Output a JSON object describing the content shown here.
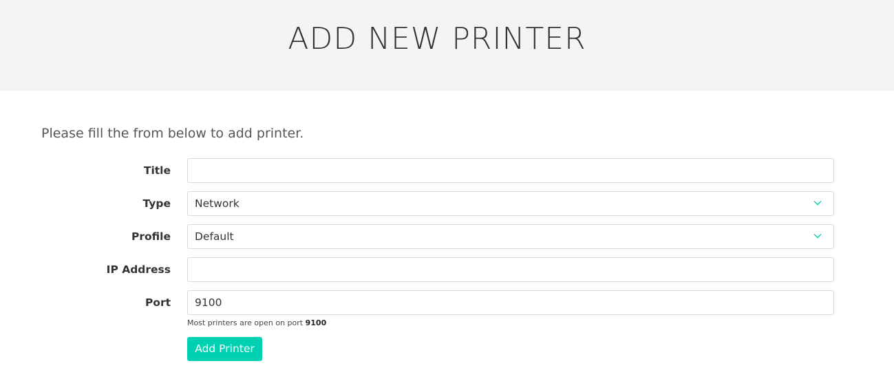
{
  "header": {
    "title": "ADD NEW PRINTER"
  },
  "form": {
    "intro": "Please fill the from below to add printer.",
    "title": {
      "label": "Title",
      "value": ""
    },
    "type": {
      "label": "Type",
      "selected": "Network"
    },
    "profile": {
      "label": "Profile",
      "selected": "Default"
    },
    "ip_address": {
      "label": "IP Address",
      "value": ""
    },
    "port": {
      "label": "Port",
      "value": "9100",
      "help_prefix": "Most printers are open on port",
      "help_port": "9100"
    },
    "submit_label": "Add Printer"
  },
  "colors": {
    "accent": "#00d1b2",
    "header_bg": "#f4f4f4"
  },
  "icons": {
    "select_arrow": "chevron-down-icon"
  }
}
